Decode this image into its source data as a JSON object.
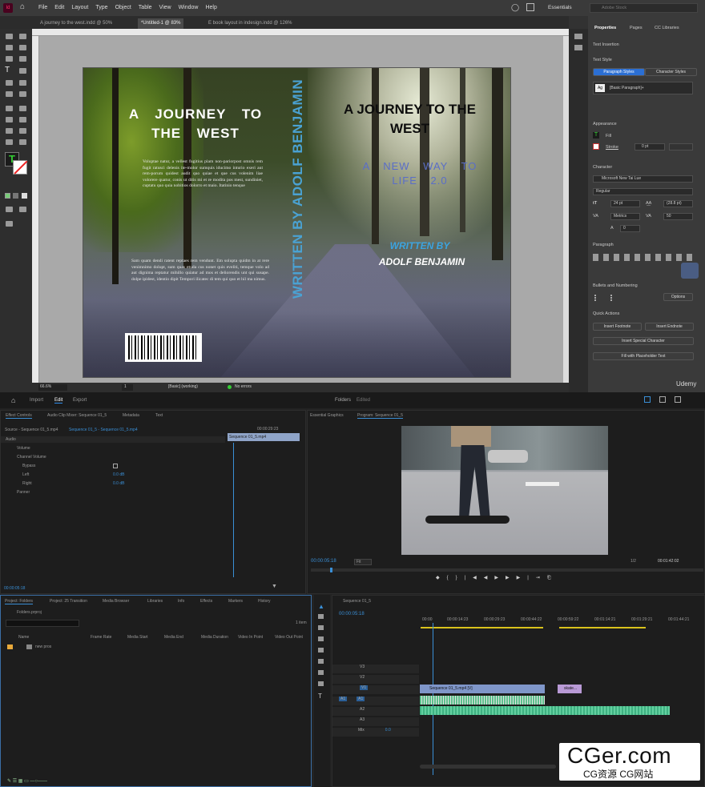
{
  "indesign": {
    "menu": [
      "File",
      "Edit",
      "Layout",
      "Type",
      "Object",
      "Table",
      "View",
      "Window",
      "Help"
    ],
    "workspace": "Essentials",
    "search_placeholder": "Adobe Stock",
    "tabs": [
      "A journey to the west.indd @ 50%",
      "*Untitled-1 @ 83%",
      "E book layout in indesign.indd @ 126%"
    ],
    "zoom": "66.6%",
    "page": "1",
    "style_mode": "[Basic] (working)",
    "errors": "No errors",
    "cover": {
      "back_title": "A JOURNEY TO THE WEST",
      "back_body": "Voluptae natur, a vellest fugitius plam non-pariorpost omnis rem fugit ratusci delenis ite-molor sumquis iducimo inturio exeri aut rem-porum quidest audit quo quiae et que cus volenim liae volorere quatur, conis ut ditis mi et re modita pos mest, sundiniet, cuptatu quo quia nobitios dolorro et maio. Itatinio tenque",
      "back_body2": "Sam quam dendi ratent reptaes rem vendunt. Em solupta quidm in at rere venimnimo dolupt, sum quas etuda cus nonet quis eveliti, temque volo ad aut dignima reptatur mihillo quiatur ad mos et deliorendis unt qui susape. dolpe ipidest, identio dipit Tempori ilicatec di tem qui quo et hil ma nimus.",
      "spine": "WRITTEN BY ADOLF BENJAMIN",
      "front_title": "A JOURNEY TO THE WEST",
      "front_subtitle": "A NEW WAY TO LIFE 2.0",
      "written_by": "WRITTEN BY",
      "author": "ADOLF BENJAMIN"
    },
    "panel": {
      "tabs": [
        "Properties",
        "Pages",
        "CC Libraries"
      ],
      "section": "Text Insertion",
      "text_style": "Text Style",
      "para_styles": "Paragraph Styles",
      "char_styles": "Character Styles",
      "para_style_value": "[Basic Paragraph]+",
      "appearance": "Appearance",
      "fill": "Fill",
      "stroke": "Stroke",
      "stroke_value": "0 pt",
      "character": "Character",
      "font": "Microsoft New Tai Lue",
      "font_style": "Regular",
      "size": "24 pt",
      "leading": "(28.8 pt)",
      "kerning": "Metrics",
      "tracking": "50",
      "tracking2": "0",
      "paragraph": "Paragraph",
      "bullets": "Bullets and Numbering",
      "options": "Options",
      "quick": "Quick Actions",
      "insert_footnote": "Insert Footnote",
      "insert_endnote": "Insert Endnote",
      "insert_special": "Insert Special Character",
      "fill_placeholder": "Fill with Placeholder Text"
    }
  },
  "premiere": {
    "header_tabs": [
      "Import",
      "Edit",
      "Export"
    ],
    "header_title": "Folders",
    "header_state": "Edited",
    "left_tabs": [
      "Effect Controls",
      "Audio Clip Mixer: Sequence 01_5",
      "Metadata",
      "Text"
    ],
    "source": "Source - Sequence 01_5.mp4",
    "seq_source": "Sequence 01_5 - Sequence 01_5.mp4",
    "ec_time": "00:00:29:23",
    "ec_clip": "Sequence 01_5.mp4",
    "ec_rows": [
      "Audio",
      "Volume",
      "Channel Volume",
      "Bypass",
      "Left",
      "Right",
      "Panner"
    ],
    "ec_left_val": "0.0 dB",
    "ec_right_val": "0.0 dB",
    "ec_timecode": "00:00:05:18",
    "program_tabs": [
      "Essential Graphics",
      "Program: Sequence 01_5"
    ],
    "prog_time": "00:00:05:18",
    "fit": "Fit",
    "ratio": "1/2",
    "duration": "00:01:42:02",
    "project_tabs": [
      "Project: Folders",
      "Project: 25 Transition",
      "Media Browser",
      "Libraries",
      "Info",
      "Effects",
      "Markers",
      "History"
    ],
    "project_file": "Folders.prproj",
    "items_count": "1 item",
    "columns": [
      "Name",
      "Frame Rate",
      "Media Start",
      "Media End",
      "Media Duration",
      "Video In Point",
      "Video Out Point"
    ],
    "bin": "new pros",
    "seq_tab": "Sequence 01_5",
    "tl_time": "00:00:05:18",
    "ruler": [
      "00:00",
      "00:00:14:23",
      "00:00:29:23",
      "00:00:44:22",
      "00:00:59:22",
      "00:01:14:21",
      "00:01:29:21",
      "00:01:44:21"
    ],
    "tracks_v": [
      "V3",
      "V2",
      "V1"
    ],
    "tracks_a": [
      "A1",
      "A2",
      "A3"
    ],
    "mix": "Mix",
    "mix_val": "0.0",
    "clip_v": "Sequence 01_5.mp4 [V]",
    "clip_v2": "skate...",
    "brand": "Udemy",
    "watermark": "CGer.com",
    "watermark_sub": "CG资源 CG网站"
  }
}
